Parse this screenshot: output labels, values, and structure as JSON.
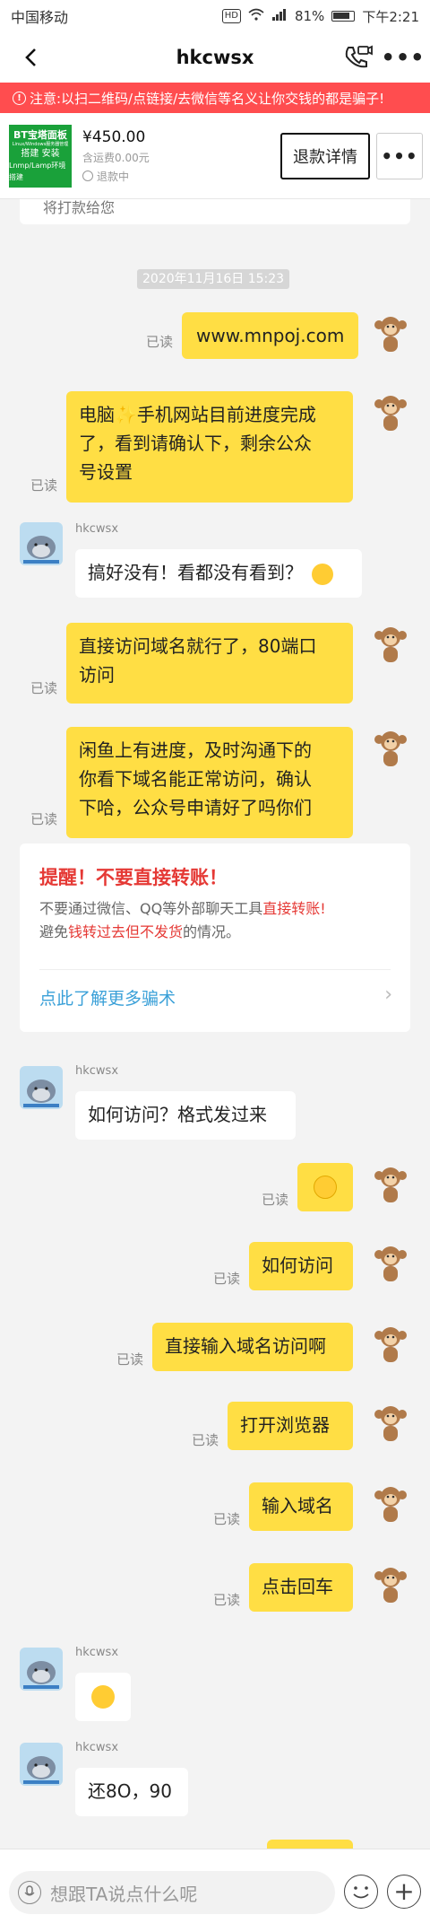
{
  "status_bar": {
    "carrier": "中国移动",
    "hd": "HD",
    "battery": "81%",
    "time": "下午2:21"
  },
  "header": {
    "title": "hkcwsx"
  },
  "warning": {
    "text": "注意:以扫二维码/点链接/去微信等名义让你交钱的都是骗子!"
  },
  "product": {
    "image_text": [
      "BT宝塔面板",
      "Linux/Windows服务器管理",
      "搭建 安装",
      "Lnmp/Lamp环境搭建"
    ],
    "price": "¥450.00",
    "shipping": "含运费0.00元",
    "status": "退款中",
    "refund_button": "退款详情"
  },
  "chat": {
    "partial_text": "将打款给您",
    "timestamp": "2020年11月16日 15:23",
    "read_label": "已读",
    "messages": [
      "www.mnpoj.com",
      "电脑✨手机网站目前进度完成了，看到请确认下，剩余公众号设置",
      "搞好没有！看都没有看到？",
      "直接访问域名就行了，80端口访问",
      "闲鱼上有进度，及时沟通下的你看下域名能正常访问，确认下哈，公众号申请好了吗你们",
      "如何访问？格式发过来",
      "如何访问",
      "直接输入域名访问啊",
      "打开浏览器",
      "输入域名",
      "点击回车",
      "还8O，90"
    ],
    "message_lines": {
      "m1": [
        "电脑✨手机网站目前进度完成",
        "了，看到请确认下，剩余公众",
        "号设置"
      ],
      "m3": [
        "直接访问域名就行了，80端口",
        "访问"
      ],
      "m4": [
        "闲鱼上有进度，及时沟通下的",
        "你看下域名能正常访问，确认",
        "下哈，公众号申请好了吗你们"
      ]
    },
    "sender_name": "hkcwsx",
    "notice": {
      "title": "提醒！不要直接转账！",
      "line1_a": "不要通过微信、QQ等外部聊天工具",
      "line1_b": "直接转账!",
      "line2_a": "避免",
      "line2_b": "钱转过去但不发货",
      "line2_c": "的情况。",
      "link": "点此了解更多骗术"
    }
  },
  "input": {
    "placeholder": "想跟TA说点什么呢"
  },
  "colors": {
    "accent_yellow": "#ffde44",
    "warning_red": "#ff4d4f",
    "link_blue": "#3aa0d8",
    "brand_green": "#1aa13a"
  }
}
